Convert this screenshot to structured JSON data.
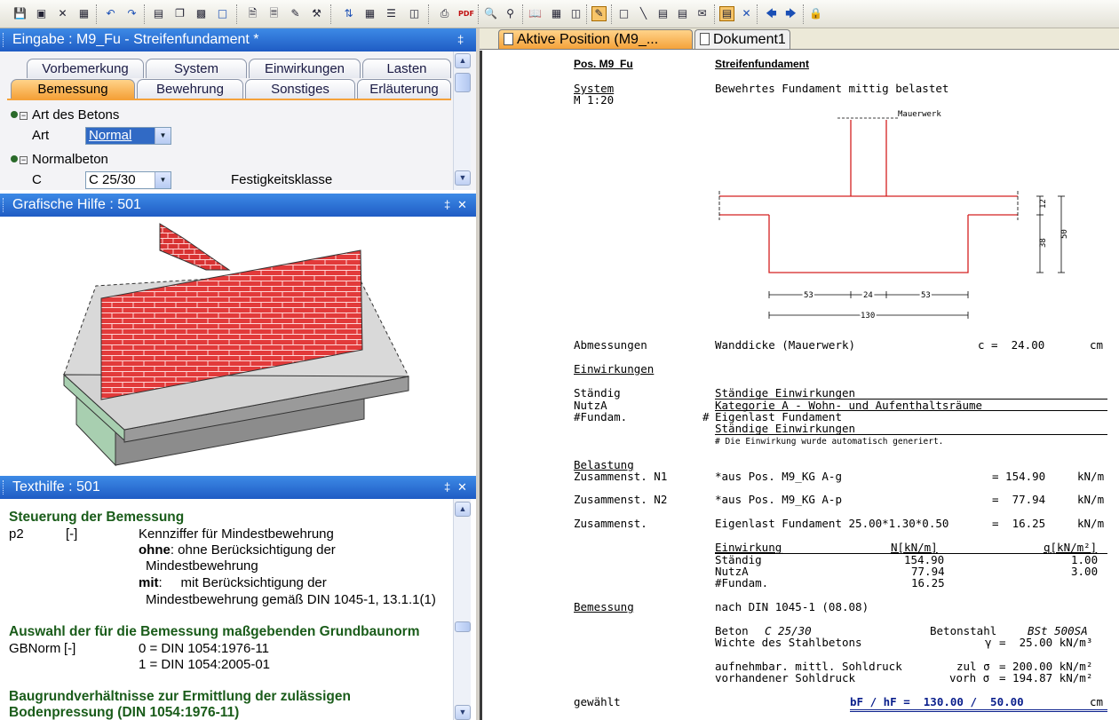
{
  "toolbar": {
    "icons": [
      "save-icon",
      "save-all-icon",
      "copy-icon",
      "close-icon",
      "properties-icon",
      "undo-icon",
      "redo-icon",
      "new-position-icon",
      "copy-position-icon",
      "paste-position-icon",
      "frame-icon",
      "doc-icon",
      "doc-save-icon",
      "doc-edit-icon",
      "doc-tools-icon",
      "sort-icon",
      "table-icon",
      "list-icon",
      "layout-icon",
      "print-icon",
      "pdf-icon",
      "zoom-in-icon",
      "zoom-out-icon",
      "book-icon",
      "calculator-icon",
      "columns-icon",
      "pen-icon",
      "rectangle-icon",
      "line-icon",
      "text-icon",
      "text2-icon",
      "comment-icon",
      "notes-icon",
      "cross-icon",
      "back-icon",
      "forward-icon",
      "lock-icon"
    ],
    "pdf_label": "PDF"
  },
  "eingabe": {
    "title": "Eingabe : M9_Fu - Streifenfundament *",
    "pin": "‡",
    "tabs_back": [
      "Vorbemerkung",
      "System",
      "Einwirkungen",
      "Lasten"
    ],
    "tabs_front": [
      "Bemessung",
      "Bewehrung",
      "Sonstiges",
      "Erläuterung"
    ],
    "group1": "Art des Betons",
    "art_label": "Art",
    "art_value": "Normal",
    "group2": "Normalbeton",
    "c_label": "C",
    "c_value": "C 25/30",
    "c_desc": "Festigkeitsklasse"
  },
  "grafik": {
    "title": "Grafische Hilfe : 501",
    "pin": "‡",
    "close": "✕"
  },
  "texthilfe": {
    "title": "Texthilfe : 501",
    "pin": "‡",
    "close": "✕",
    "h1": "Steuerung der Bemessung",
    "p2_name": "p2",
    "p2_unit": "[-]",
    "p2_desc": "Kennziffer für Mindestbewehrung",
    "ohne_kw": "ohne",
    "ohne_text": ": ohne Berücksichtigung der",
    "ohne_text2": "Mindestbewehrung",
    "mit_kw": "mit",
    "mit_text": ":     mit Berücksichtigung der",
    "mit_text2": "Mindestbewehrung gemäß DIN 1045-1, 13.1.1(1)",
    "h2": "Auswahl der für die Bemessung maßgebenden Grundbaunorm",
    "gb_name": "GBNorm",
    "gb_unit": "[-]",
    "gb_opt0": "0 = DIN 1054:1976-11",
    "gb_opt1": "1 = DIN 1054:2005-01",
    "h3a": "Baugrundverhältnisse zur Ermittlung der zulässigen",
    "h3b": "Bodenpressung (DIN 1054:1976-11)"
  },
  "doctabs": [
    "Aktive Position (M9_...",
    "Dokument1"
  ],
  "doc": {
    "pos": "Pos. M9_Fu",
    "title": "Streifenfundament",
    "system": "System",
    "scale": "M 1:20",
    "system_desc": "Bewehrtes Fundament mittig belastet",
    "mauerwerk": "Mauerwerk",
    "dim_12": "12",
    "dim_38": "38",
    "dim_50": "50",
    "dim_53a": "53",
    "dim_24": "24",
    "dim_53b": "53",
    "dim_130": "130",
    "abm_label": "Abmessungen",
    "abm_text": "Wanddicke (Mauerwerk)",
    "abm_val": "c =  24.00",
    "abm_unit": "cm",
    "einw": "Einwirkungen",
    "e1_l": "Ständig",
    "e1_r": "Ständige Einwirkungen",
    "e2_l": "NutzA",
    "e2_r": "Kategorie A - Wohn- und Aufenthaltsräume",
    "e3_l": "#Fundam.",
    "e3_hash": "#",
    "e3_r": "Eigenlast Fundament",
    "e3_r2": "Ständige Einwirkungen",
    "e_note": "# Die Einwirkung wurde automatisch generiert.",
    "bel": "Belastung",
    "b1_l": "Zusammenst. N1",
    "b1_m": "*aus Pos. M9_KG A-g",
    "b1_v": "= 154.90",
    "b1_u": "kN/m",
    "b2_l": "Zusammenst. N2",
    "b2_m": "*aus Pos. M9_KG A-p",
    "b2_v": "=  77.94",
    "b2_u": "kN/m",
    "b3_l": "Zusammenst.",
    "b3_m": "Eigenlast Fundament 25.00*1.30*0.50",
    "b3_v": "=  16.25",
    "b3_u": "kN/m",
    "t_h1": "Einwirkung",
    "t_h2": "N[kN/m]",
    "t_h3": "q[kN/m²]",
    "t_rows": [
      [
        "Ständig",
        "154.90",
        "1.00"
      ],
      [
        "NutzA",
        "77.94",
        "3.00"
      ],
      [
        "#Fundam.",
        "16.25",
        ""
      ]
    ],
    "bem": "Bemessung",
    "bem_norm": "nach DIN 1045-1 (08.08)",
    "beton_l": "Beton",
    "beton_v": "C 25/30",
    "stahl_l": "Betonstahl",
    "stahl_v": "BSt 500SA",
    "wichte_l": "Wichte des Stahlbetons",
    "wichte_sym": "γ",
    "wichte_v": "=  25.00 kN/m³",
    "sohl1_l": "aufnehmbar. mittl. Sohldruck",
    "sohl1_sym": "zul σ",
    "sohl1_v": "= 200.00 kN/m²",
    "sohl2_l": "vorhandener Sohldruck",
    "sohl2_sym": "vorh σ",
    "sohl2_v": "= 194.87 kN/m²",
    "gew_l": "gewählt",
    "gew_v": "bF / hF =  130.00 /  50.00",
    "gew_u": "cm"
  }
}
